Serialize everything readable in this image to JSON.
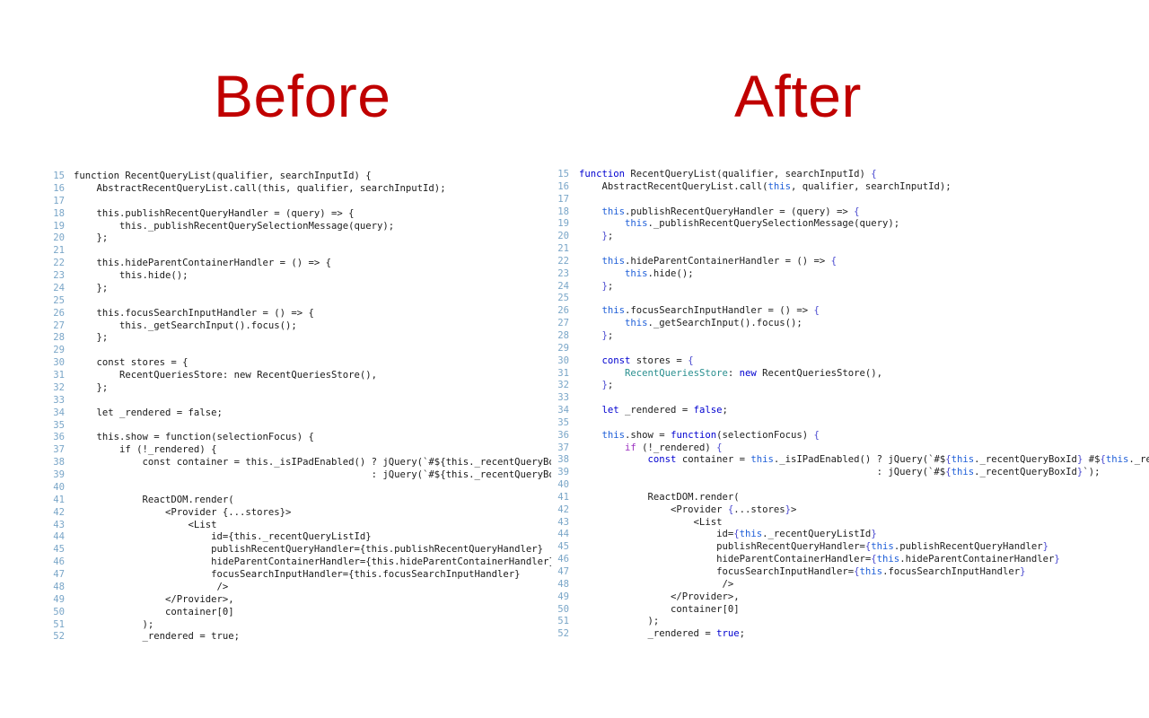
{
  "headings": {
    "before": "Before",
    "after": "After",
    "color": "#C00000"
  },
  "colors": {
    "background": "#FFFFFF",
    "line_number": "#7AA6C8",
    "plain_text": "#1A1A1A",
    "keyword": "#0000D0",
    "this_keyword": "#1F5FD8",
    "property": "#2A8F8F",
    "control": "#9B30C0",
    "brace": "#4A4AD0"
  },
  "before_panel": {
    "name": "Before",
    "highlighted": false,
    "first_line_number": 15,
    "last_line_number": 52,
    "line_numbers": [
      15,
      16,
      17,
      18,
      19,
      20,
      21,
      22,
      23,
      24,
      25,
      26,
      27,
      28,
      29,
      30,
      31,
      32,
      33,
      34,
      35,
      36,
      37,
      38,
      39,
      40,
      41,
      42,
      43,
      44,
      45,
      46,
      47,
      48,
      49,
      50,
      51,
      52
    ],
    "lines": [
      "function RecentQueryList(qualifier, searchInputId) {",
      "    AbstractRecentQueryList.call(this, qualifier, searchInputId);",
      "",
      "    this.publishRecentQueryHandler = (query) => {",
      "        this._publishRecentQuerySelectionMessage(query);",
      "    };",
      "",
      "    this.hideParentContainerHandler = () => {",
      "        this.hide();",
      "    };",
      "",
      "    this.focusSearchInputHandler = () => {",
      "        this._getSearchInput().focus();",
      "    };",
      "",
      "    const stores = {",
      "        RecentQueriesStore: new RecentQueriesStore(),",
      "    };",
      "",
      "    let _rendered = false;",
      "",
      "    this.show = function(selectionFocus) {",
      "        if (!_rendered) {",
      "            const container = this._isIPadEnabled() ? jQuery(`#${this._recentQueryBoxId} #${this._recentQueryListId}`)",
      "                                                    : jQuery(`#${this._recentQueryBoxId}`);",
      "",
      "            ReactDOM.render(",
      "                <Provider {...stores}>",
      "                    <List",
      "                        id={this._recentQueryListId}",
      "                        publishRecentQueryHandler={this.publishRecentQueryHandler}",
      "                        hideParentContainerHandler={this.hideParentContainerHandler}",
      "                        focusSearchInputHandler={this.focusSearchInputHandler}",
      "                         />",
      "                </Provider>,",
      "                container[0]",
      "            );",
      "            _rendered = true;"
    ]
  },
  "after_panel": {
    "name": "After",
    "highlighted": true,
    "first_line_number": 15,
    "last_line_number": 52,
    "line_numbers": [
      15,
      16,
      17,
      18,
      19,
      20,
      21,
      22,
      23,
      24,
      25,
      26,
      27,
      28,
      29,
      30,
      31,
      32,
      33,
      34,
      35,
      36,
      37,
      38,
      39,
      40,
      41,
      42,
      43,
      44,
      45,
      46,
      47,
      48,
      49,
      50,
      51,
      52
    ],
    "tokens": [
      [
        [
          "function",
          "kw"
        ],
        [
          " RecentQueryList(qualifier, searchInputId) ",
          "plain"
        ],
        [
          "{",
          "brace"
        ]
      ],
      [
        [
          "    AbstractRecentQueryList.call(",
          "plain"
        ],
        [
          "this",
          "this"
        ],
        [
          ", qualifier, searchInputId);",
          "plain"
        ]
      ],
      [],
      [
        [
          "    ",
          "plain"
        ],
        [
          "this",
          "this"
        ],
        [
          ".publishRecentQueryHandler = (query) => ",
          "plain"
        ],
        [
          "{",
          "brace"
        ]
      ],
      [
        [
          "        ",
          "plain"
        ],
        [
          "this",
          "this"
        ],
        [
          "._publishRecentQuerySelectionMessage(query);",
          "plain"
        ]
      ],
      [
        [
          "    ",
          "plain"
        ],
        [
          "}",
          "brace"
        ],
        [
          ";",
          "plain"
        ]
      ],
      [],
      [
        [
          "    ",
          "plain"
        ],
        [
          "this",
          "this"
        ],
        [
          ".hideParentContainerHandler = () => ",
          "plain"
        ],
        [
          "{",
          "brace"
        ]
      ],
      [
        [
          "        ",
          "plain"
        ],
        [
          "this",
          "this"
        ],
        [
          ".hide();",
          "plain"
        ]
      ],
      [
        [
          "    ",
          "plain"
        ],
        [
          "}",
          "brace"
        ],
        [
          ";",
          "plain"
        ]
      ],
      [],
      [
        [
          "    ",
          "plain"
        ],
        [
          "this",
          "this"
        ],
        [
          ".focusSearchInputHandler = () => ",
          "plain"
        ],
        [
          "{",
          "brace"
        ]
      ],
      [
        [
          "        ",
          "plain"
        ],
        [
          "this",
          "this"
        ],
        [
          "._getSearchInput().focus();",
          "plain"
        ]
      ],
      [
        [
          "    ",
          "plain"
        ],
        [
          "}",
          "brace"
        ],
        [
          ";",
          "plain"
        ]
      ],
      [],
      [
        [
          "    ",
          "plain"
        ],
        [
          "const",
          "kw"
        ],
        [
          " stores = ",
          "plain"
        ],
        [
          "{",
          "brace"
        ]
      ],
      [
        [
          "        ",
          "plain"
        ],
        [
          "RecentQueriesStore",
          "prop"
        ],
        [
          ": ",
          "plain"
        ],
        [
          "new",
          "kw"
        ],
        [
          " RecentQueriesStore(),",
          "plain"
        ]
      ],
      [
        [
          "    ",
          "plain"
        ],
        [
          "}",
          "brace"
        ],
        [
          ";",
          "plain"
        ]
      ],
      [],
      [
        [
          "    ",
          "plain"
        ],
        [
          "let",
          "kw"
        ],
        [
          " _rendered = ",
          "plain"
        ],
        [
          "false",
          "kw"
        ],
        [
          ";",
          "plain"
        ]
      ],
      [],
      [
        [
          "    ",
          "plain"
        ],
        [
          "this",
          "this"
        ],
        [
          ".show = ",
          "plain"
        ],
        [
          "function",
          "kw"
        ],
        [
          "(selectionFocus) ",
          "plain"
        ],
        [
          "{",
          "brace"
        ]
      ],
      [
        [
          "        ",
          "plain"
        ],
        [
          "if",
          "ctrl"
        ],
        [
          " (!_rendered) ",
          "plain"
        ],
        [
          "{",
          "brace"
        ]
      ],
      [
        [
          "            ",
          "plain"
        ],
        [
          "const",
          "kw"
        ],
        [
          " container = ",
          "plain"
        ],
        [
          "this",
          "this"
        ],
        [
          "._isIPadEnabled() ? jQuery(`#$",
          "plain"
        ],
        [
          "{",
          "brace"
        ],
        [
          "this",
          "this"
        ],
        [
          "._recentQueryBoxId",
          "plain"
        ],
        [
          "}",
          "brace"
        ],
        [
          " #$",
          "plain"
        ],
        [
          "{",
          "brace"
        ],
        [
          "this",
          "this"
        ],
        [
          "._recentQueryListId",
          "plain"
        ],
        [
          "}",
          "brace"
        ],
        [
          "`)",
          "plain"
        ]
      ],
      [
        [
          "                                                    : jQuery(`#$",
          "plain"
        ],
        [
          "{",
          "brace"
        ],
        [
          "this",
          "this"
        ],
        [
          "._recentQueryBoxId",
          "plain"
        ],
        [
          "}",
          "brace"
        ],
        [
          "`);",
          "plain"
        ]
      ],
      [],
      [
        [
          "            ReactDOM.render(",
          "plain"
        ]
      ],
      [
        [
          "                <Provider ",
          "plain"
        ],
        [
          "{",
          "brace"
        ],
        [
          "...stores",
          "plain"
        ],
        [
          "}",
          "brace"
        ],
        [
          ">",
          "plain"
        ]
      ],
      [
        [
          "                    <List",
          "plain"
        ]
      ],
      [
        [
          "                        id=",
          "plain"
        ],
        [
          "{",
          "brace"
        ],
        [
          "this",
          "this"
        ],
        [
          "._recentQueryListId",
          "plain"
        ],
        [
          "}",
          "brace"
        ]
      ],
      [
        [
          "                        publishRecentQueryHandler=",
          "plain"
        ],
        [
          "{",
          "brace"
        ],
        [
          "this",
          "this"
        ],
        [
          ".publishRecentQueryHandler",
          "plain"
        ],
        [
          "}",
          "brace"
        ]
      ],
      [
        [
          "                        hideParentContainerHandler=",
          "plain"
        ],
        [
          "{",
          "brace"
        ],
        [
          "this",
          "this"
        ],
        [
          ".hideParentContainerHandler",
          "plain"
        ],
        [
          "}",
          "brace"
        ]
      ],
      [
        [
          "                        focusSearchInputHandler=",
          "plain"
        ],
        [
          "{",
          "brace"
        ],
        [
          "this",
          "this"
        ],
        [
          ".focusSearchInputHandler",
          "plain"
        ],
        [
          "}",
          "brace"
        ]
      ],
      [
        [
          "                         />",
          "plain"
        ]
      ],
      [
        [
          "                </Provider>,",
          "plain"
        ]
      ],
      [
        [
          "                container[0]",
          "plain"
        ]
      ],
      [
        [
          "            );",
          "plain"
        ]
      ],
      [
        [
          "            _rendered = ",
          "plain"
        ],
        [
          "true",
          "kw"
        ],
        [
          ";",
          "plain"
        ]
      ]
    ]
  }
}
